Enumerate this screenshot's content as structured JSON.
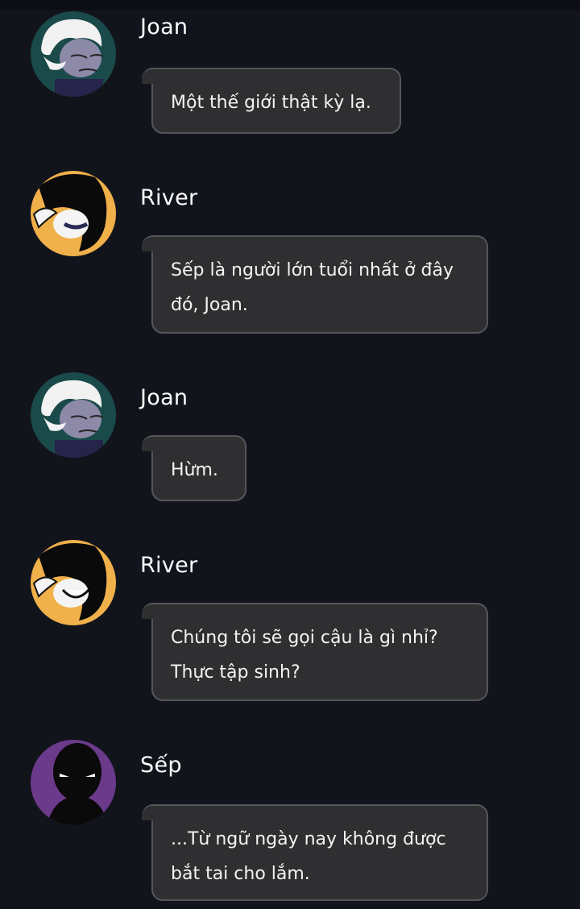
{
  "messages": [
    {
      "sender": "Joan",
      "text": "Một thế giới thật kỳ lạ.",
      "avatar": "elderly-man-avatar-icon"
    },
    {
      "sender": "River",
      "text": "Sếp là người lớn tuổi nhất ở đây\nđó, Joan.",
      "avatar": "black-hair-avatar-icon"
    },
    {
      "sender": "Joan",
      "text": "Hừm.",
      "avatar": "elderly-man-avatar-icon"
    },
    {
      "sender": "River",
      "text": "Chúng tôi sẽ gọi cậu là gì nhỉ?\nThực tập sinh?",
      "avatar": "black-hair-avatar-icon"
    },
    {
      "sender": "Sếp",
      "text": "...Từ ngữ ngày nay không được\nbắt tai cho lắm.",
      "avatar": "shadow-figure-avatar-icon"
    }
  ],
  "colors": {
    "background": "#12141c",
    "bubble": "#2f2f31",
    "bubble_border": "#55565a",
    "text": "#f4f4f4",
    "joan_avatar_bg": "#1a4a4a",
    "river_avatar_bg": "#f0b04a",
    "boss_avatar_bg": "#6b3a8a"
  }
}
